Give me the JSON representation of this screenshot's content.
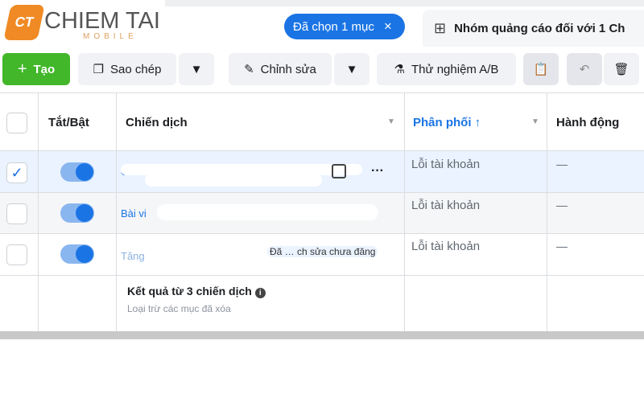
{
  "logo": {
    "mark": "CT",
    "name": "CHIEM TAI",
    "sub": "MOBILE"
  },
  "selection": {
    "label": "Đã chọn 1 mục",
    "close": "×"
  },
  "tab": {
    "label": "Nhóm quảng cáo đối với 1 Ch",
    "icon": "grid-icon"
  },
  "toolbar": {
    "create": "Tạo",
    "copy": "Sao chép",
    "edit": "Chỉnh sửa",
    "ab_test": "Thử nghiệm A/B"
  },
  "table": {
    "headers": {
      "toggle": "Tắt/Bật",
      "campaign": "Chiến dịch",
      "delivery": "Phân phối ↑",
      "action": "Hành động"
    },
    "rows": [
      {
        "name": "Chư",
        "delivery": "Lỗi tài khoản",
        "action": "—",
        "selected": true,
        "on": true
      },
      {
        "name": "Bài vi",
        "delivery": "Lỗi tài khoản",
        "action": "—",
        "selected": false,
        "on": true
      },
      {
        "name": "Tăng",
        "extra": "Đã … ch sửa chưa đăng",
        "delivery": "Lỗi tài khoản",
        "action": "—",
        "selected": false,
        "on": true
      }
    ],
    "summary": {
      "title": "Kết quả từ 3 chiến dịch",
      "note": "Loại trừ các mục đã xóa"
    }
  },
  "colors": {
    "accent": "#1b74e4",
    "create": "#42b72a",
    "selected_row": "#eaf3ff"
  }
}
